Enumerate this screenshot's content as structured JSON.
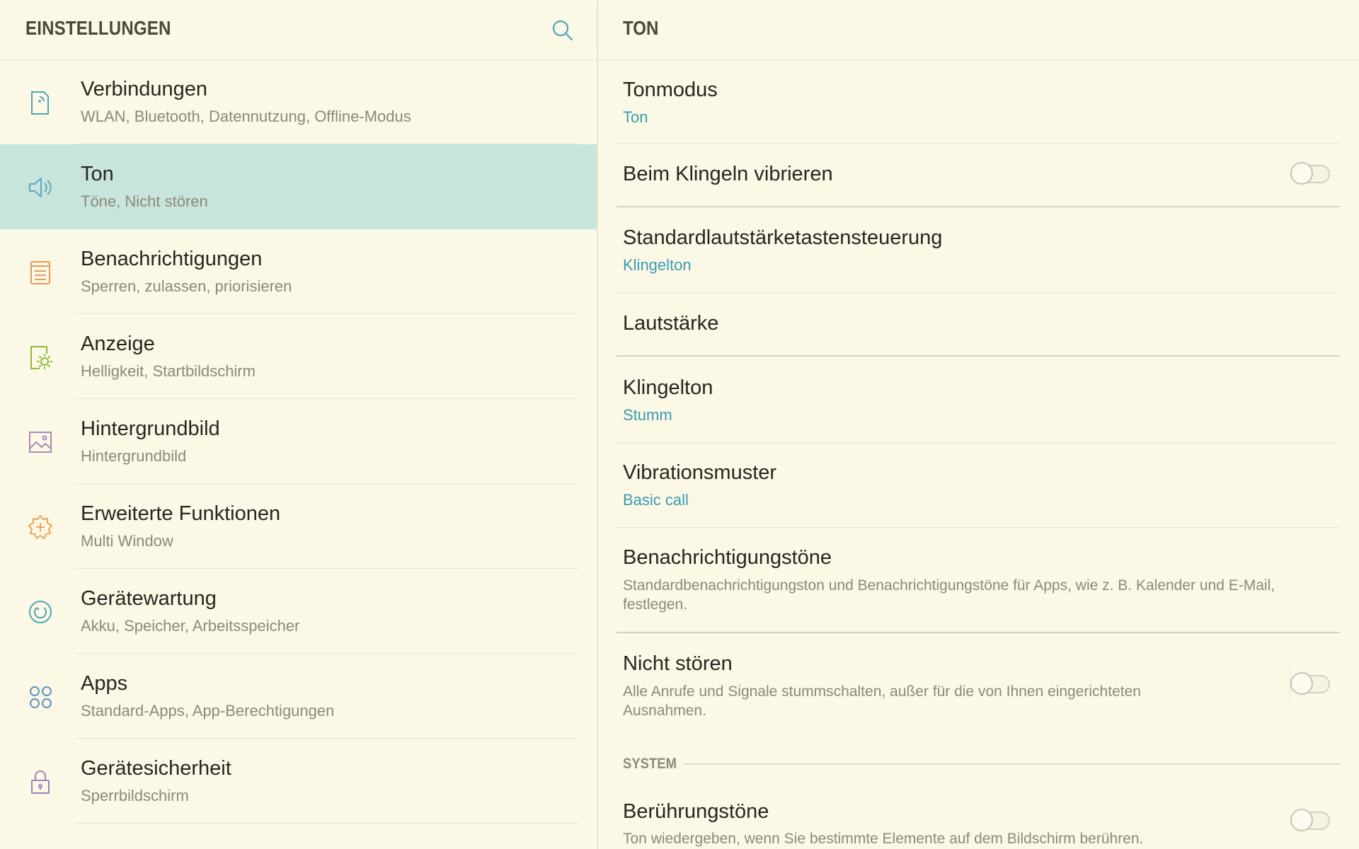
{
  "left": {
    "title": "EINSTELLUNGEN",
    "search_icon": "search-icon",
    "items": [
      {
        "id": "verbindungen",
        "title": "Verbindungen",
        "subtitle": "WLAN, Bluetooth, Datennutzung, Offline-Modus",
        "icon": "connections-icon",
        "color": "#4ea6b8"
      },
      {
        "id": "ton",
        "title": "Ton",
        "subtitle": "Töne, Nicht stören",
        "icon": "speaker-icon",
        "color": "#5aa9bd",
        "active": true
      },
      {
        "id": "benachrichtigungen",
        "title": "Benachrichtigungen",
        "subtitle": "Sperren, zulassen, priorisieren",
        "icon": "notifications-icon",
        "color": "#e39a5b"
      },
      {
        "id": "anzeige",
        "title": "Anzeige",
        "subtitle": "Helligkeit, Startbildschirm",
        "icon": "display-icon",
        "color": "#8fb83b"
      },
      {
        "id": "hintergrundbild",
        "title": "Hintergrundbild",
        "subtitle": "Hintergrundbild",
        "icon": "wallpaper-icon",
        "color": "#a98ab8"
      },
      {
        "id": "erweiterte",
        "title": "Erweiterte Funktionen",
        "subtitle": "Multi Window",
        "icon": "advanced-features-icon",
        "color": "#eda35e"
      },
      {
        "id": "geraetewartung",
        "title": "Gerätewartung",
        "subtitle": "Akku, Speicher, Arbeitsspeicher",
        "icon": "device-maintenance-icon",
        "color": "#4ea6b8"
      },
      {
        "id": "apps",
        "title": "Apps",
        "subtitle": "Standard-Apps, App-Berechtigungen",
        "icon": "apps-icon",
        "color": "#5e92c2"
      },
      {
        "id": "geraetesicherheit",
        "title": "Gerätesicherheit",
        "subtitle": "Sperrbildschirm",
        "icon": "lock-icon",
        "color": "#9c82bf"
      }
    ]
  },
  "right": {
    "title": "TON",
    "tonmodus": {
      "title": "Tonmodus",
      "value": "Ton"
    },
    "vibrieren": {
      "title": "Beim Klingeln vibrieren",
      "on": false
    },
    "standard": {
      "title": "Standardlautstärketastensteuerung",
      "value": "Klingelton"
    },
    "lautstaerke": {
      "title": "Lautstärke"
    },
    "klingelton": {
      "title": "Klingelton",
      "value": "Stumm"
    },
    "vibrationsmuster": {
      "title": "Vibrationsmuster",
      "value": "Basic call"
    },
    "benachrichtigungstoene": {
      "title": "Benachrichtigungstöne",
      "desc": "Standardbenachrichtigungston und Benachrichtigungstöne für Apps, wie z. B. Kalender und E-Mail, festlegen."
    },
    "nicht_stoeren": {
      "title": "Nicht stören",
      "desc": "Alle Anrufe und Signale stummschalten, außer für die von Ihnen eingerichteten Ausnahmen.",
      "on": false
    },
    "section_system": "SYSTEM",
    "beruehrungstoene": {
      "title": "Berührungstöne",
      "desc": "Ton wiedergeben, wenn Sie bestimmte Elemente auf dem Bildschirm berühren.",
      "on": false
    }
  }
}
